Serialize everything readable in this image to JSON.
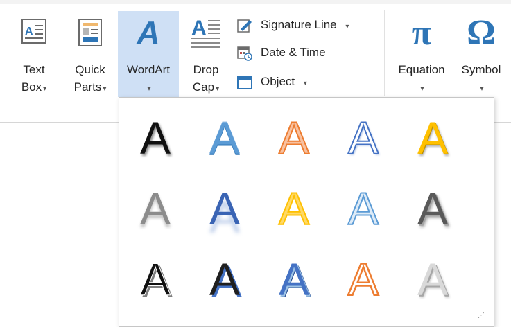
{
  "ribbon": {
    "text_box": {
      "line1": "Text",
      "line2": "Box"
    },
    "quick_parts": {
      "line1": "Quick",
      "line2": "Parts"
    },
    "wordart": {
      "label": "WordArt"
    },
    "drop_cap": {
      "line1": "Drop",
      "line2": "Cap"
    },
    "signature_line": {
      "label": "Signature Line"
    },
    "date_time": {
      "label": "Date & Time"
    },
    "object": {
      "label": "Object"
    },
    "equation": {
      "label": "Equation",
      "glyph": "π"
    },
    "symbol": {
      "label": "Symbol",
      "glyph": "Ω"
    },
    "dropdown_glyph": "▾",
    "wordart_glyph": "A",
    "drop_cap_glyph": "A"
  },
  "gallery": {
    "styles": [
      {
        "glyph": "A",
        "style": "black-shadow"
      },
      {
        "glyph": "A",
        "style": "blue-gradient"
      },
      {
        "glyph": "A",
        "style": "orange-outline"
      },
      {
        "glyph": "A",
        "style": "white-blue-outline"
      },
      {
        "glyph": "A",
        "style": "gold-bevel"
      },
      {
        "glyph": "A",
        "style": "gray-gradient"
      },
      {
        "glyph": "A",
        "style": "blue-reflection"
      },
      {
        "glyph": "A",
        "style": "yellow-gradient"
      },
      {
        "glyph": "A",
        "style": "light-blue-outline"
      },
      {
        "glyph": "A",
        "style": "gray-bevel"
      },
      {
        "glyph": "A",
        "style": "black-white-outline"
      },
      {
        "glyph": "A",
        "style": "black-blue-shadow"
      },
      {
        "glyph": "A",
        "style": "blue-bevel-shadow"
      },
      {
        "glyph": "A",
        "style": "orange-white-outline"
      },
      {
        "glyph": "A",
        "style": "silver-gradient"
      }
    ],
    "resize_grip": "⋰"
  },
  "colors": {
    "accent_blue": "#2e75b6",
    "selected_bg": "#cfe0f5"
  }
}
